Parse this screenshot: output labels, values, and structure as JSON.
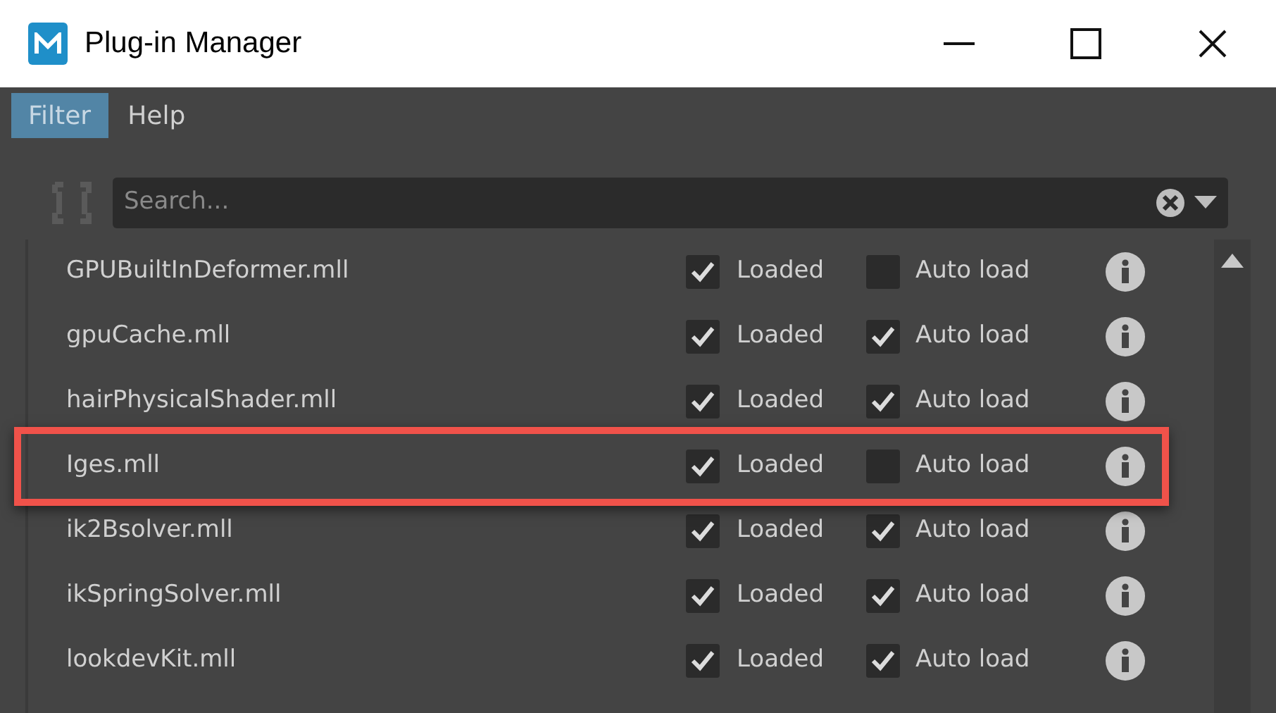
{
  "window": {
    "title": "Plug-in Manager"
  },
  "menu": [
    {
      "label": "Filter",
      "selected": true
    },
    {
      "label": "Help",
      "selected": false
    }
  ],
  "search": {
    "placeholder": "Search..."
  },
  "plugins": [
    {
      "name": "GPUBuiltInDeformer.mll",
      "loaded": true,
      "loaded_label": "Loaded",
      "auto_load": false,
      "auto_load_label": "Auto load",
      "highlighted": false
    },
    {
      "name": "gpuCache.mll",
      "loaded": true,
      "loaded_label": "Loaded",
      "auto_load": true,
      "auto_load_label": "Auto load",
      "highlighted": false
    },
    {
      "name": "hairPhysicalShader.mll",
      "loaded": true,
      "loaded_label": "Loaded",
      "auto_load": true,
      "auto_load_label": "Auto load",
      "highlighted": false
    },
    {
      "name": "Iges.mll",
      "loaded": true,
      "loaded_label": "Loaded",
      "auto_load": false,
      "auto_load_label": "Auto load",
      "highlighted": true
    },
    {
      "name": "ik2Bsolver.mll",
      "loaded": true,
      "loaded_label": "Loaded",
      "auto_load": true,
      "auto_load_label": "Auto load",
      "highlighted": false
    },
    {
      "name": "ikSpringSolver.mll",
      "loaded": true,
      "loaded_label": "Loaded",
      "auto_load": true,
      "auto_load_label": "Auto load",
      "highlighted": false
    },
    {
      "name": "lookdevKit.mll",
      "loaded": true,
      "loaded_label": "Loaded",
      "auto_load": true,
      "auto_load_label": "Auto load",
      "highlighted": false
    }
  ]
}
